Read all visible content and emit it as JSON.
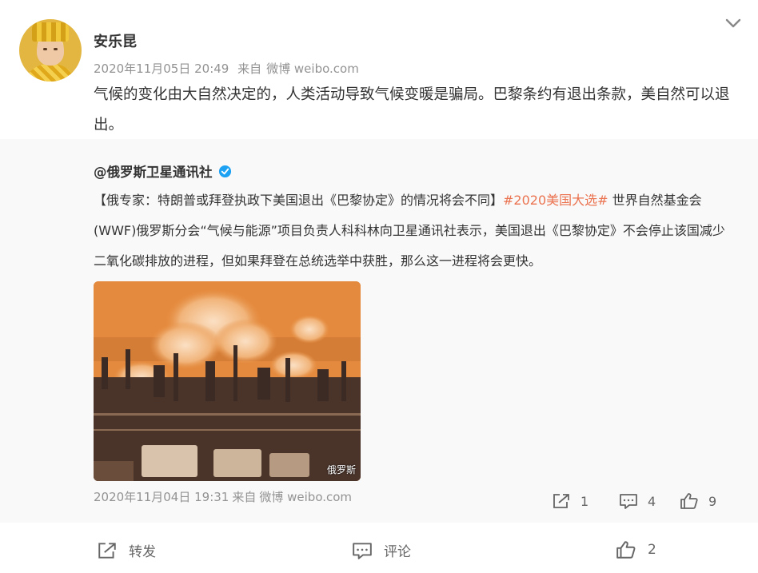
{
  "post": {
    "username": "安乐昆",
    "date": "2020年11月05日 20:49",
    "source_prefix": "来自",
    "source": "微博 weibo.com",
    "text": "气候的变化由大自然决定的，人类活动导致气候变暖是骗局。巴黎条约有退出条款，美自然可以退出。"
  },
  "repost": {
    "author": "@俄罗斯卫星通讯社",
    "text_before": "【俄专家：特朗普或拜登执政下美国退出《巴黎协定》的情况将会不同】",
    "hashtag": "#2020美国大选#",
    "text_after": " 世界自然基金会(WWF)俄罗斯分会“气候与能源”项目负责人科科林向卫星通讯社表示，美国退出《巴黎协定》不会停止该国减少二氧化碳排放的进程，但如果拜登在总统选举中获胜，那么这一进程将会更快。",
    "image_watermark": "俄罗斯",
    "date": "2020年11月04日 19:31",
    "source_prefix": "来自",
    "source": "微博 weibo.com",
    "actions": {
      "repost_count": "1",
      "comment_count": "4",
      "like_count": "9"
    }
  },
  "bottom_actions": {
    "repost_label": "转发",
    "comment_label": "评论",
    "like_count": "2"
  },
  "icons": {
    "chevron": "chevron-down-icon",
    "verified": "verified-badge-icon",
    "repost": "repost-icon",
    "comment": "comment-icon",
    "like": "like-icon"
  },
  "colors": {
    "hashtag": "#eb7350",
    "meta_text": "#939393",
    "verified_blue": "#1da1f2",
    "repost_bg": "#f9f9f9"
  }
}
